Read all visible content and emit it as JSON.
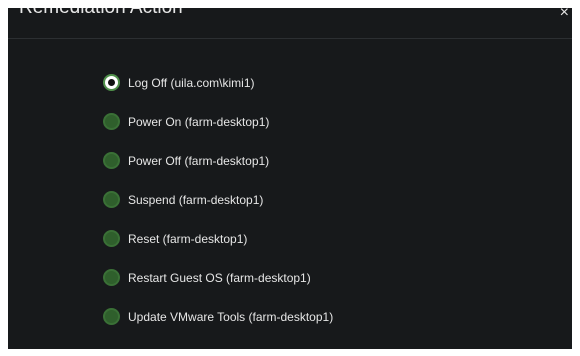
{
  "dialog": {
    "title": "Remediation Action",
    "close_icon": "close-icon",
    "close_glyph": "×"
  },
  "options": [
    {
      "label": "Log Off (uila.com\\kimi1)",
      "checked": true
    },
    {
      "label": "Power On (farm-desktop1)",
      "checked": false
    },
    {
      "label": "Power Off (farm-desktop1)",
      "checked": false
    },
    {
      "label": "Suspend (farm-desktop1)",
      "checked": false
    },
    {
      "label": "Reset (farm-desktop1)",
      "checked": false
    },
    {
      "label": "Restart Guest OS (farm-desktop1)",
      "checked": false
    },
    {
      "label": "Update VMware Tools (farm-desktop1)",
      "checked": false
    }
  ],
  "colors": {
    "background": "#17191b",
    "radio_unchecked": "#2f5f2c",
    "text": "#e6e6e6"
  }
}
